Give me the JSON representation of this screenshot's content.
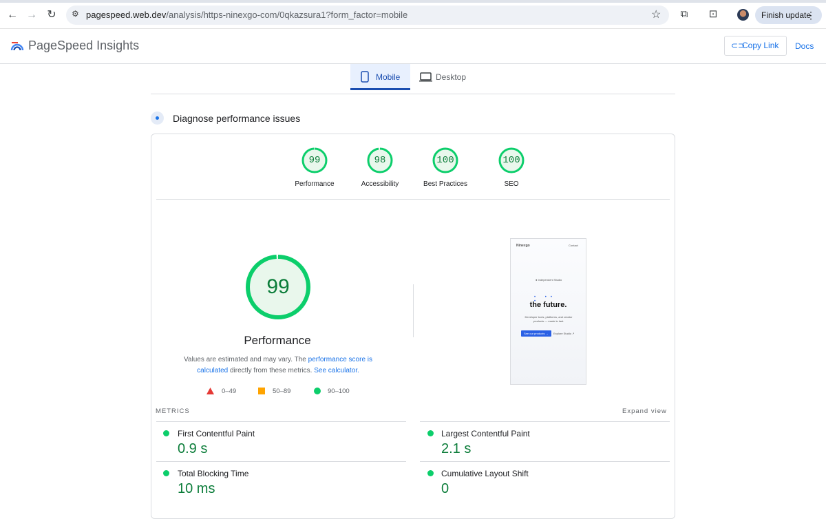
{
  "browser": {
    "url_host": "pagespeed.web.dev",
    "url_path": "/analysis/https-ninexgo-com/0qkazsura1?form_factor=mobile",
    "finish_update_label": "Finish update"
  },
  "header": {
    "brand": "PageSpeed Insights",
    "copy_link": "Copy Link",
    "docs": "Docs"
  },
  "tabs": [
    {
      "label": "Mobile",
      "active": true
    },
    {
      "label": "Desktop",
      "active": false
    }
  ],
  "section_title": "Diagnose performance issues",
  "scores": [
    {
      "label": "Performance",
      "value": 99
    },
    {
      "label": "Accessibility",
      "value": 98
    },
    {
      "label": "Best Practices",
      "value": 100
    },
    {
      "label": "SEO",
      "value": 100
    }
  ],
  "performance": {
    "score": 99,
    "title": "Performance",
    "note_prefix": "Values are estimated and may vary. The ",
    "note_link1": "performance score is calculated",
    "note_middle": " directly from these metrics. ",
    "note_link2": "See calculator."
  },
  "legend": [
    {
      "range": "0–49",
      "color": "#e53935"
    },
    {
      "range": "50–89",
      "color": "#ffa400"
    },
    {
      "range": "90–100",
      "color": "#0cce6b"
    }
  ],
  "screenshot": {
    "logo_text": "Ninexgo",
    "nav_text": "Contact",
    "kicker": "● Independent Studio",
    "headline": "the future.",
    "body": "Developer tools, platforms, and creator products — made to last.",
    "cta_primary": "See our products →",
    "cta_secondary": "Explore Studio ↗"
  },
  "metrics": {
    "header": "METRICS",
    "expand": "Expand view",
    "items": [
      {
        "name": "First Contentful Paint",
        "value": "0.9 s"
      },
      {
        "name": "Largest Contentful Paint",
        "value": "2.1 s"
      },
      {
        "name": "Total Blocking Time",
        "value": "10 ms"
      },
      {
        "name": "Cumulative Layout Shift",
        "value": "0"
      }
    ]
  },
  "colors": {
    "good": "#0cce6b",
    "good_text": "#0c7d3a",
    "accent": "#1a73e8"
  }
}
